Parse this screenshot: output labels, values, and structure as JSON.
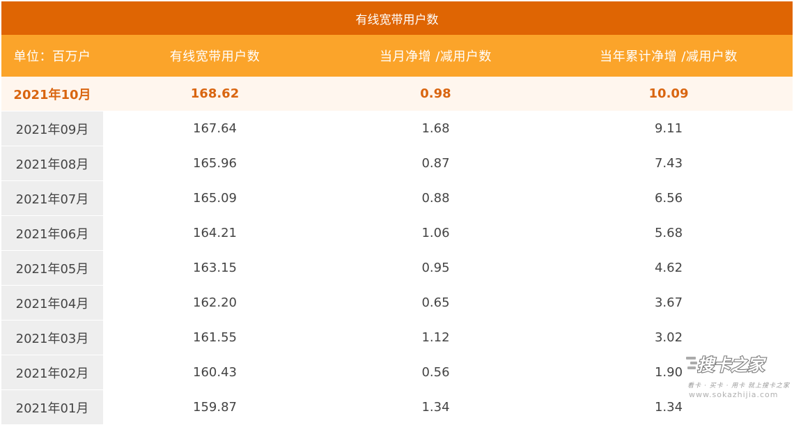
{
  "table": {
    "title": "有线宽带用户数",
    "headers": [
      "单位：百万户",
      "有线宽带用户数",
      "当月净增 /减用户数",
      "当年累计净增 /减用户数"
    ],
    "rows": [
      [
        "2021年10月",
        "168.62",
        "0.98",
        "10.09"
      ],
      [
        "2021年09月",
        "167.64",
        "1.68",
        "9.11"
      ],
      [
        "2021年08月",
        "165.96",
        "0.87",
        "7.43"
      ],
      [
        "2021年07月",
        "165.09",
        "0.88",
        "6.56"
      ],
      [
        "2021年06月",
        "164.21",
        "1.06",
        "5.68"
      ],
      [
        "2021年05月",
        "163.15",
        "0.95",
        "4.62"
      ],
      [
        "2021年04月",
        "162.20",
        "0.65",
        "3.67"
      ],
      [
        "2021年03月",
        "161.55",
        "1.12",
        "3.02"
      ],
      [
        "2021年02月",
        "160.43",
        "0.56",
        "1.90"
      ],
      [
        "2021年01月",
        "159.87",
        "1.34",
        "1.34"
      ]
    ]
  },
  "watermark": {
    "logo_text": "搜卡之家",
    "tagline": "看卡 · 买卡 · 用卡 就上搜卡之家",
    "url": "www.sokazhijia.com"
  },
  "colors": {
    "title_bg": "#df6503",
    "header_bg": "#fba42a",
    "highlight_text": "#d96510",
    "highlight_bg": "#fff6ee",
    "first_col_bg": "#eeeeee"
  }
}
